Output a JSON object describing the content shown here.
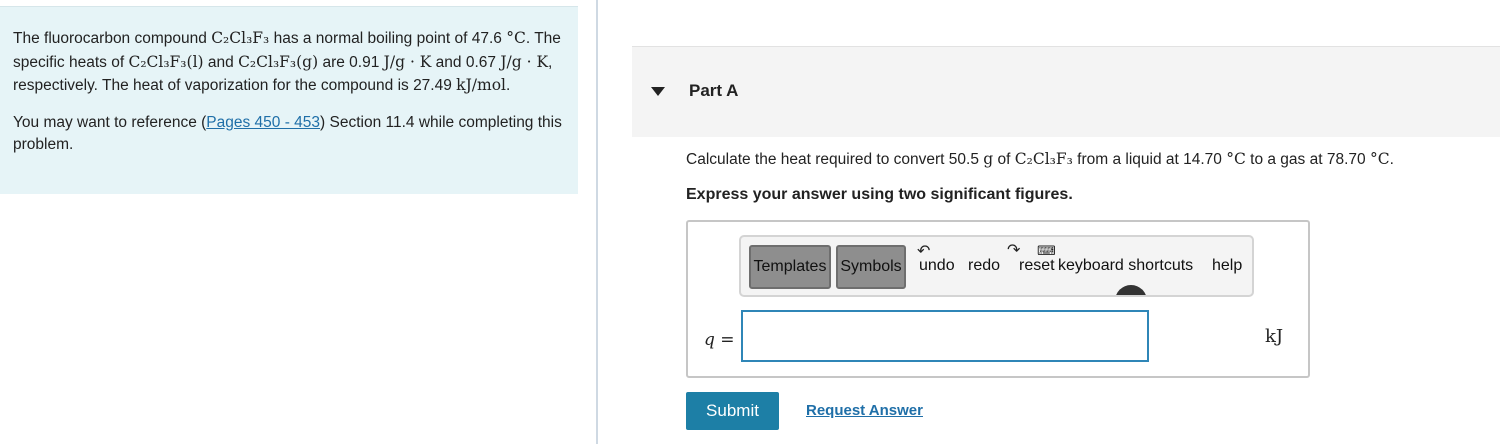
{
  "problem": {
    "intro_1": "The fluorocarbon compound ",
    "compound": "C₂Cl₃F₃",
    "intro_2": " has a normal boiling point of 47.6 ",
    "deg_c": "°C",
    "intro_3": ". The specific heats of ",
    "liquid_phase": "C₂Cl₃F₃(l)",
    "intro_4": " and ",
    "gas_phase": "C₂Cl₃F₃(g)",
    "intro_5": " are 0.91 ",
    "unit_jgk_1": "J/g · K",
    "intro_6": " and 0.67 ",
    "unit_jgk_2": "J/g · K",
    "intro_7": ", respectively. The heat of vaporization for the compound is 27.49 ",
    "unit_kjmol": "kJ/mol",
    "intro_8": ".",
    "ref_1": "You may want to reference (",
    "ref_link": "Pages 450 - 453",
    "ref_2": ") Section 11.4 while completing this problem."
  },
  "part": {
    "title": "Part A",
    "q_1": "Calculate the heat required to convert 50.5 ",
    "q_g": "g",
    "q_2": " of ",
    "q_compound": "C₂Cl₃F₃",
    "q_3": " from a liquid at 14.70 ",
    "q_deg1": "°C",
    "q_4": " to a gas at 78.70 ",
    "q_deg2": "°C",
    "q_5": ".",
    "instruction": "Express your answer using two significant figures."
  },
  "toolbar": {
    "templates": "Templates",
    "symbols": "Symbols",
    "undo": "undo",
    "redo": "redo",
    "reset": "reset",
    "keyboard": "keyboard shortcuts",
    "help": "help"
  },
  "answer": {
    "variable": "q =",
    "value": "",
    "unit": "kJ"
  },
  "buttons": {
    "submit": "Submit",
    "request": "Request Answer"
  },
  "icons": {
    "caret": "caret-down-icon",
    "undo": "undo-icon",
    "redo": "redo-icon",
    "keyboard": "keyboard-icon"
  },
  "colors": {
    "panel_bg": "#e6f4f7",
    "accent": "#1d7fa6",
    "link": "#1f6fa8"
  }
}
